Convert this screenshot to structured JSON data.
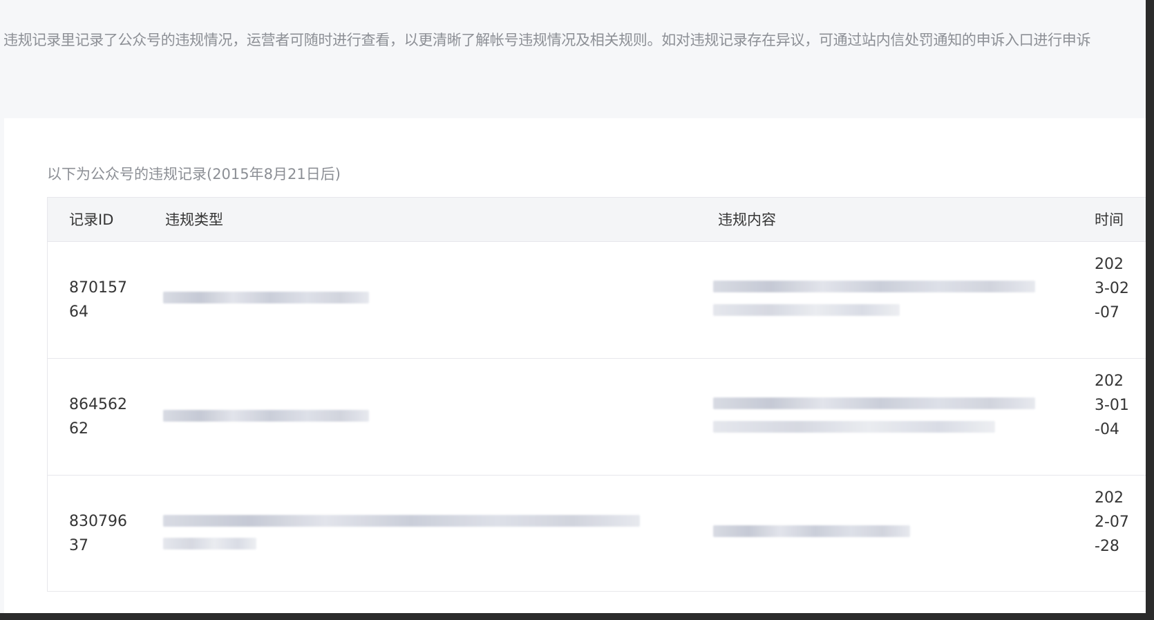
{
  "notice": "违规记录里记录了公众号的违规情况，运营者可随时进行查看，以更清晰了解帐号违规情况及相关规则。如对违规记录存在异议，可通过站内信处罚通知的申诉入口进行申诉",
  "caption": "以下为公众号的违规记录(2015年8月21日后)",
  "table": {
    "columns": {
      "id": "记录ID",
      "type": "违规类型",
      "content": "违规内容",
      "time": "时间"
    },
    "rows": [
      {
        "id": "87015764",
        "time": "2023-02-07"
      },
      {
        "id": "86456262",
        "time": "2023-01-04"
      },
      {
        "id": "83079637",
        "time": "2022-07-28"
      }
    ]
  }
}
